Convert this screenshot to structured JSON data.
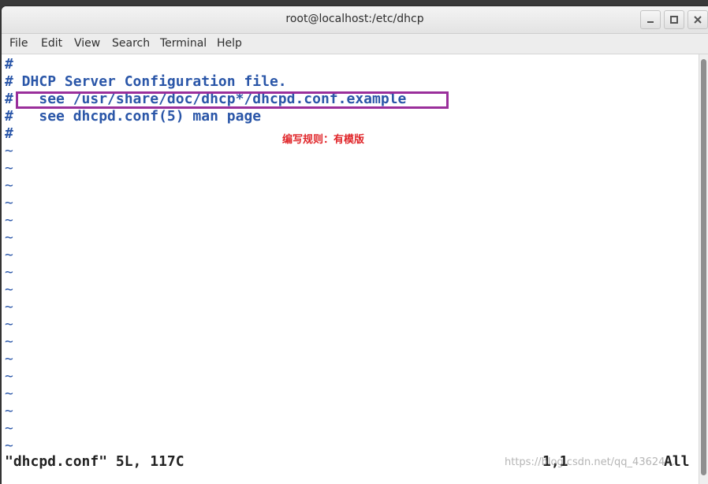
{
  "window": {
    "title": "root@localhost:/etc/dhcp"
  },
  "menu": [
    "File",
    "Edit",
    "View",
    "Search",
    "Terminal",
    "Help"
  ],
  "editor": {
    "lines": [
      {
        "hash": "#",
        "text": ""
      },
      {
        "hash": "#",
        "text": " DHCP Server Configuration file."
      },
      {
        "hash": "#",
        "text": "   see /usr/share/doc/dhcp*/dhcpd.conf.example"
      },
      {
        "hash": "#",
        "text": "   see dhcpd.conf(5) man page"
      },
      {
        "hash": "#",
        "text": ""
      }
    ],
    "tilde": "~",
    "annotation": "编写规则：有模版",
    "status_file": "\"dhcpd.conf\" 5L, 117C",
    "status_position": "1,1",
    "status_scroll": "All"
  },
  "watermark": "https://blog.csdn.net/qq_43624...",
  "colors": {
    "code_blue": "#2a56a8",
    "annotation_red": "#e0262a",
    "highlight_purple": "#9a2f9b"
  }
}
